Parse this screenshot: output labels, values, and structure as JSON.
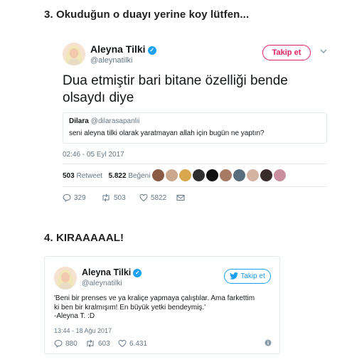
{
  "headings": {
    "first": "3. Okuduğun o duayı yerine koy lütfen...",
    "second": "4. KIRAAAAAL!"
  },
  "tweet1": {
    "name": "Aleyna Tilki",
    "handle": "@aleynatilki",
    "follow_label": "Takip et",
    "text": "Dua etmiştir bari bitane özelliği bende olsaydı diye",
    "quote": {
      "name": "Dilara",
      "handle": "@dilarasapanlii",
      "text": "seni aleyna tilki olarak yaratmayan allah için bugün ne yaptın?"
    },
    "time": "02:46 - 05 Eyl 2017",
    "retweets_count": "503",
    "retweets_label": "Retweet",
    "likes_count": "5.822",
    "likes_label": "Beğeni",
    "actions": {
      "replies": "329",
      "retweets": "503",
      "likes": "5822"
    }
  },
  "tweet2": {
    "name": "Aleyna Tilki",
    "handle": "@aleynatilki",
    "follow_label": "Takip et",
    "text": "'Beni bir prenses ve ya kraliçe yapmaya çalıştılar. Ama farkettim\nki ben bir kralmışım! En büyük yetki bendeymiş.'\n-Aleyna T. :D",
    "time": "13:44 - 18 Ağu 2017",
    "actions": {
      "replies": "880",
      "retweets": "603",
      "likes": "6.431"
    }
  },
  "colors": {
    "brand_blue": "#1da1f2",
    "follow_red": "#e0245e",
    "muted": "#657786",
    "face_colors": [
      "#8a5a44",
      "#caa88f",
      "#d9a84e",
      "#2f2f2f",
      "#111111",
      "#a77a63",
      "#5a6d7c",
      "#d5b3a3",
      "#3a2b2b",
      "#c98fa0",
      "#6c6c6c"
    ]
  }
}
